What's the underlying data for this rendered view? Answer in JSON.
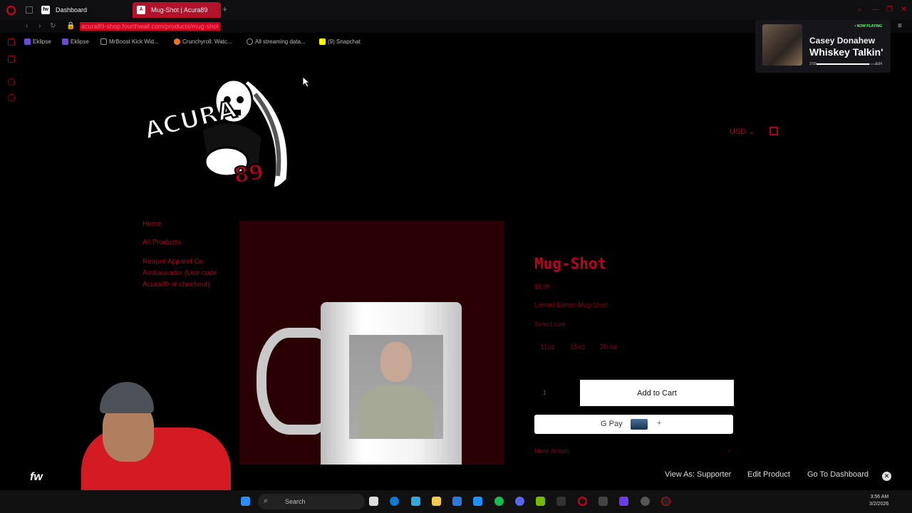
{
  "browser": {
    "tabs": [
      {
        "label": "Dashboard",
        "favicon": "fw"
      },
      {
        "label": "Mug-Shot | Acura89",
        "favicon": "A"
      }
    ],
    "url": "acura89-shop.fourthwall.com/products/mug-shot",
    "bookmarks": [
      "Eklipse",
      "Eklipse",
      "MrBoost Kick Wid...",
      "Crunchyroll: Watc...",
      "All streaming data...",
      "(9) Snapchat"
    ]
  },
  "now_playing": {
    "badge": "• NOW PLAYING",
    "artist": "Casey Donahew",
    "song": "Whiskey Talkin'",
    "elapsed": "2:59",
    "duration": "3:34",
    "progress": 0.84
  },
  "header": {
    "currency": "USD",
    "cart_icon": "shopping-bag-icon"
  },
  "nav": {
    "home": "Home",
    "all_products": "All Products",
    "reaper": "Reaper Apparel Co Ambassador (Use code Acura89 at checkout)"
  },
  "product": {
    "title": "Mug-Shot",
    "price": "$8.00",
    "description": "Limited Edition Mug-Shot!",
    "select_size": "Select size",
    "sizes": [
      "11oz",
      "15oz",
      "20 oz"
    ],
    "quantity": "1",
    "add_to_cart": "Add to Cart",
    "gpay_label": "G Pay",
    "more_details": "More details"
  },
  "admin_bar": {
    "brand": "fw",
    "view_as": "View As: Supporter",
    "edit": "Edit Product",
    "dashboard": "Go To Dashboard"
  },
  "taskbar": {
    "search": "Search",
    "time": "3:56 AM",
    "date": "3/2/2026"
  },
  "colors": {
    "accent": "#c0001f",
    "tab_active": "#b3122b",
    "product_bg": "#2a0005"
  }
}
